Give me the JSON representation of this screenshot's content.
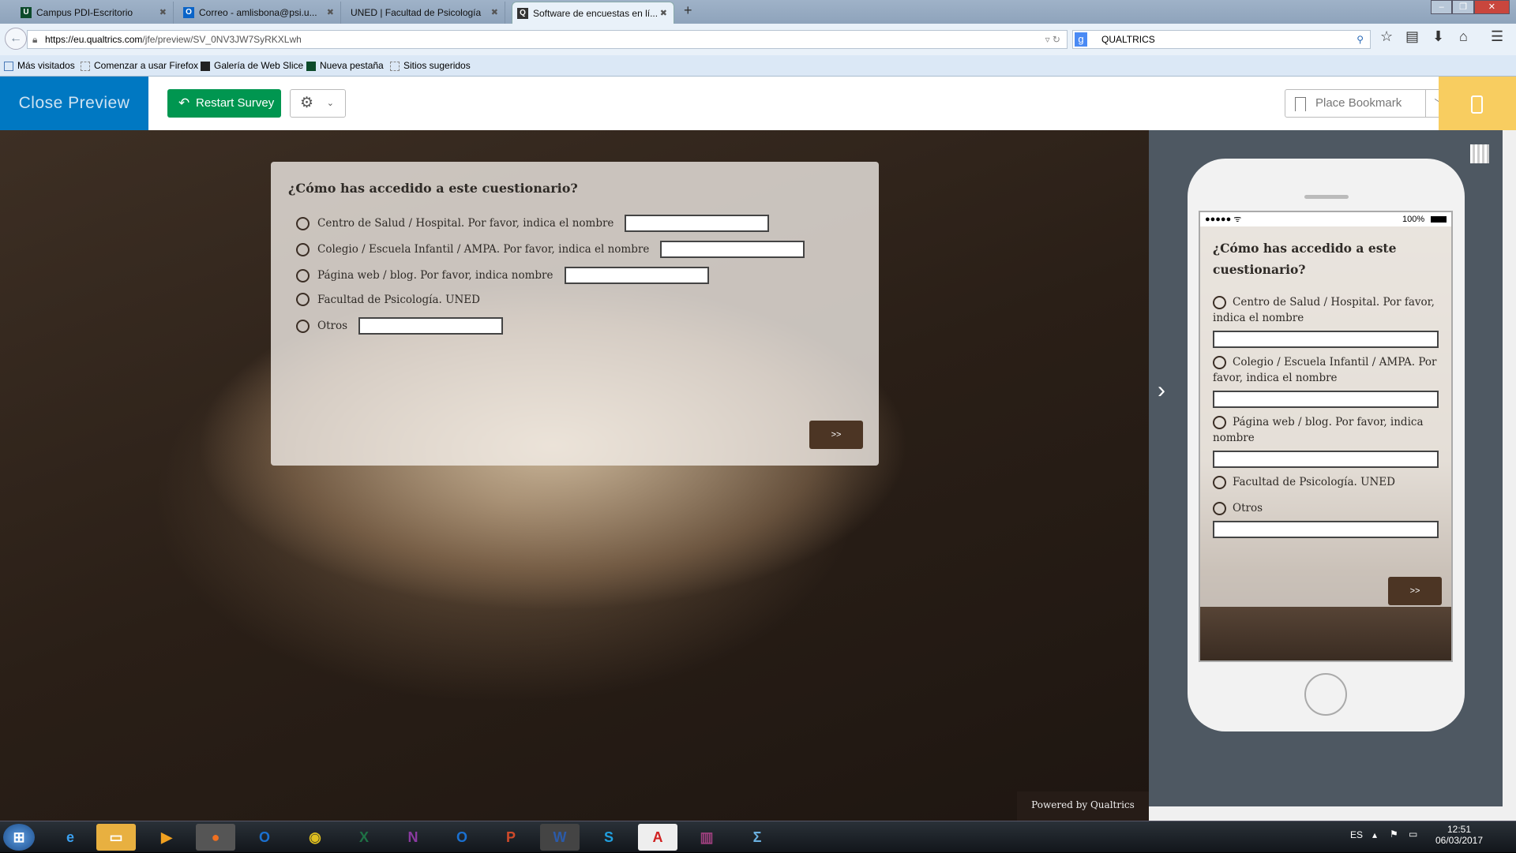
{
  "browser": {
    "tabs": [
      {
        "label": "Campus PDI-Escritorio",
        "icon": "uned-icon"
      },
      {
        "label": "Correo - amlisbona@psi.u...",
        "icon": "outlook-icon"
      },
      {
        "label": "UNED | Facultad de Psicología",
        "icon": ""
      },
      {
        "label": "Software de encuestas en lí...",
        "icon": "qualtrics-icon",
        "active": true
      }
    ],
    "new_tab": "+",
    "url_host": "https://eu.qualtrics.com",
    "url_path": "/jfe/preview/SV_0NV3JW7SyRKXLwh",
    "search_engine": "g",
    "search_value": "QUALTRICS",
    "bookmarks": [
      "Más visitados",
      "Comenzar a usar Firefox",
      "Galería de Web Slice",
      "Nueva pestaña",
      "Sitios sugeridos"
    ]
  },
  "preview_header": {
    "close_preview": "Close Preview",
    "restart_survey": "Restart Survey",
    "place_bookmark": "Place Bookmark",
    "accent_blue": "#0078c2",
    "accent_green": "#009650",
    "accent_yellow": "#f8cd60"
  },
  "survey": {
    "question": "¿Cómo has accedido a este cuestionario?",
    "options": [
      {
        "label": "Centro de Salud / Hospital. Por favor, indica el nombre",
        "text_entry": "",
        "has_text": true
      },
      {
        "label": "Colegio / Escuela Infantil / AMPA. Por favor, indica el nombre",
        "text_entry": "",
        "has_text": true
      },
      {
        "label": "Página web / blog. Por favor, indica nombre",
        "text_entry": "",
        "has_text": true
      },
      {
        "label": "Facultad de Psicología. UNED",
        "has_text": false
      },
      {
        "label": "Otros",
        "text_entry": "",
        "has_text": true
      }
    ],
    "next_button": ">>",
    "powered_by": "Powered by Qualtrics",
    "button_color": "#4c3524"
  },
  "mobile": {
    "signal": "●●●●● ᯤ",
    "battery": "100%"
  },
  "taskbar": {
    "apps": [
      "Start",
      "Internet Explorer",
      "Explorador",
      "Media Player",
      "Firefox",
      "Outlook",
      "Chrome",
      "Excel",
      "OneNote",
      "Outlook",
      "PowerPoint",
      "Word",
      "Skype",
      "Acrobat",
      "WinRAR",
      "Math"
    ],
    "language": "ES",
    "time": "12:51",
    "date": "06/03/2017"
  }
}
